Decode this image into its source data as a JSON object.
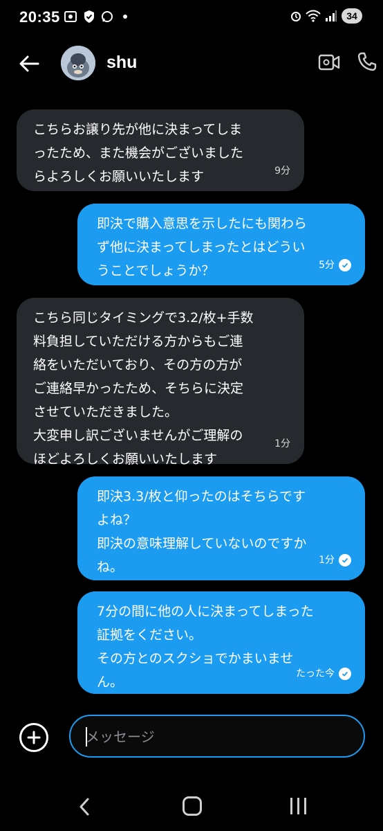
{
  "status_bar": {
    "time": "20:35",
    "battery": "34"
  },
  "header": {
    "contact_name": "shu"
  },
  "messages": [
    {
      "direction": "incoming",
      "text": "こちらお譲り先が他に決まってしま\nったため、また機会がございました\nらよろしくお願いいたします",
      "time": "9分"
    },
    {
      "direction": "outgoing",
      "text": "即決で購入意思を示したにも関わら\nず他に決まってしまったとはどうい\nうことでしょうか？",
      "time": "5分"
    },
    {
      "direction": "incoming",
      "text": "こちら同じタイミングで3.2/枚+手数\n料負担していただける方からもご連\n絡をいただいており、その方の方が\nご連絡早かったため、そちらに決定\nさせていただきました。\n大変申し訳ございませんがご理解の\nほどよろしくお願いいたします",
      "time": "1分"
    },
    {
      "direction": "outgoing",
      "text": "即決3.3/枚と仰ったのはそちらです\nよね？\n即決の意味理解していないのですか\nね。",
      "time": "1分"
    },
    {
      "direction": "outgoing",
      "text": "7分の間に他の人に決まってしまった\n証拠をください。\nその方とのスクショでかまいませ\nん。",
      "time": "たった今"
    }
  ],
  "composer": {
    "placeholder": "メッセージ"
  },
  "colors": {
    "outgoing_bubble": "#1c9cf0",
    "incoming_bubble": "#262a2f",
    "background": "#000000"
  }
}
